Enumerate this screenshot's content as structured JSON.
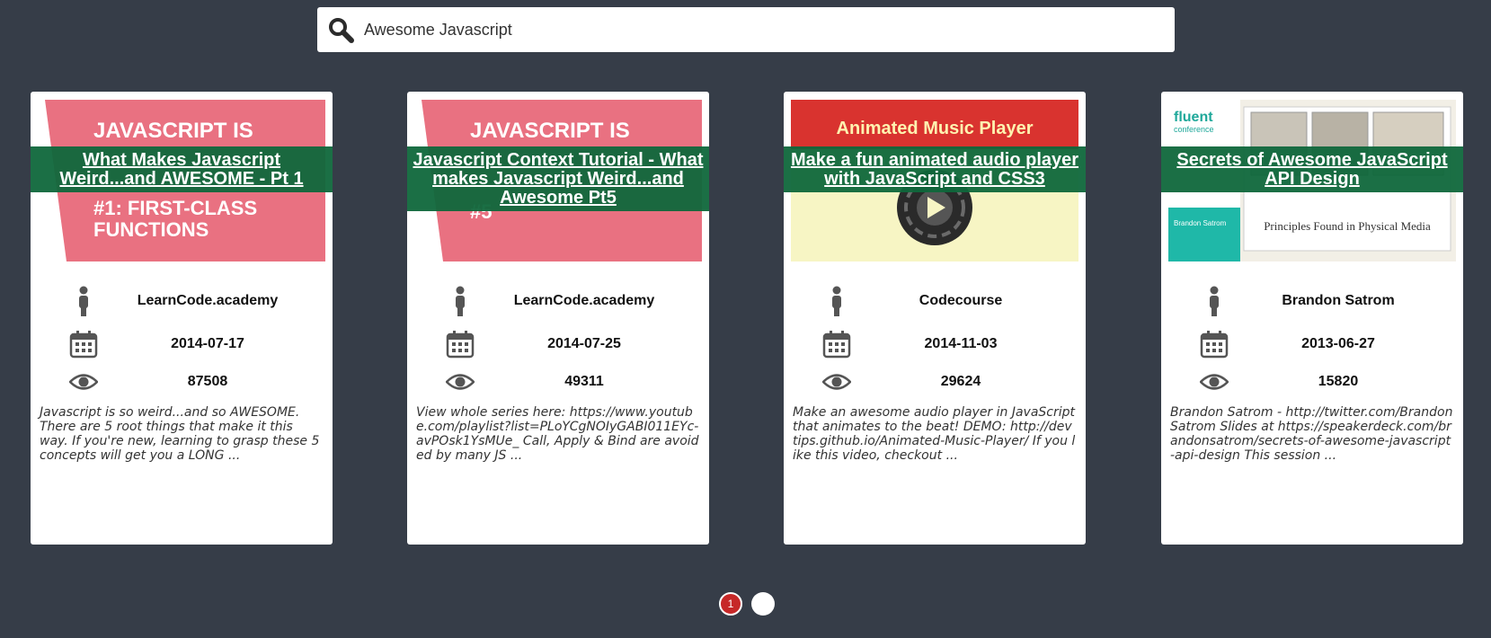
{
  "search": {
    "value": "Awesome Javascript"
  },
  "cards": [
    {
      "title": "What Makes Javascript Weird...and AWESOME - Pt 1",
      "thumb": {
        "headline": "JAVASCRIPT IS",
        "sub1": "#1: FIRST-CLASS",
        "sub2": "FUNCTIONS"
      },
      "author": "LearnCode.academy",
      "date": "2014-07-17",
      "views": "87508",
      "description": "Javascript is so weird...and so AWESOME. There are 5 root things that make it this way. If you're new, learning to grasp these 5 concepts will get you a LONG ..."
    },
    {
      "title": "Javascript Context Tutorial - What makes Javascript Weird...and Awesome Pt5",
      "thumb": {
        "headline": "JAVASCRIPT IS",
        "sub1": "#5",
        "sub2": ""
      },
      "author": "LearnCode.academy",
      "date": "2014-07-25",
      "views": "49311",
      "description": "View whole series here: https://www.youtube.com/playlist?list=PLoYCgNOIyGABI011EYc-avPOsk1YsMUe_ Call, Apply & Bind are avoided by many JS ..."
    },
    {
      "title": "Make a fun animated audio player with JavaScript and CSS3",
      "thumb": {
        "headline": "Animated Music Player"
      },
      "author": "Codecourse",
      "date": "2014-11-03",
      "views": "29624",
      "description": "Make an awesome audio player in JavaScript that animates to the beat! DEMO: http://devtips.github.io/Animated-Music-Player/ If you like this video, checkout ..."
    },
    {
      "title": "Secrets of Awesome JavaScript API Design",
      "thumb": {
        "brand": "fluent",
        "brand_sub": "conference",
        "speaker": "Brandon Satrom",
        "caption": "Principles Found in Physical Media"
      },
      "author": "Brandon Satrom",
      "date": "2013-06-27",
      "views": "15820",
      "description": "Brandon Satrom - http://twitter.com/BrandonSatrom Slides at https://speakerdeck.com/brandonsatrom/secrets-of-awesome-javascript-api-design This session ..."
    }
  ],
  "pager": {
    "current": "1"
  }
}
